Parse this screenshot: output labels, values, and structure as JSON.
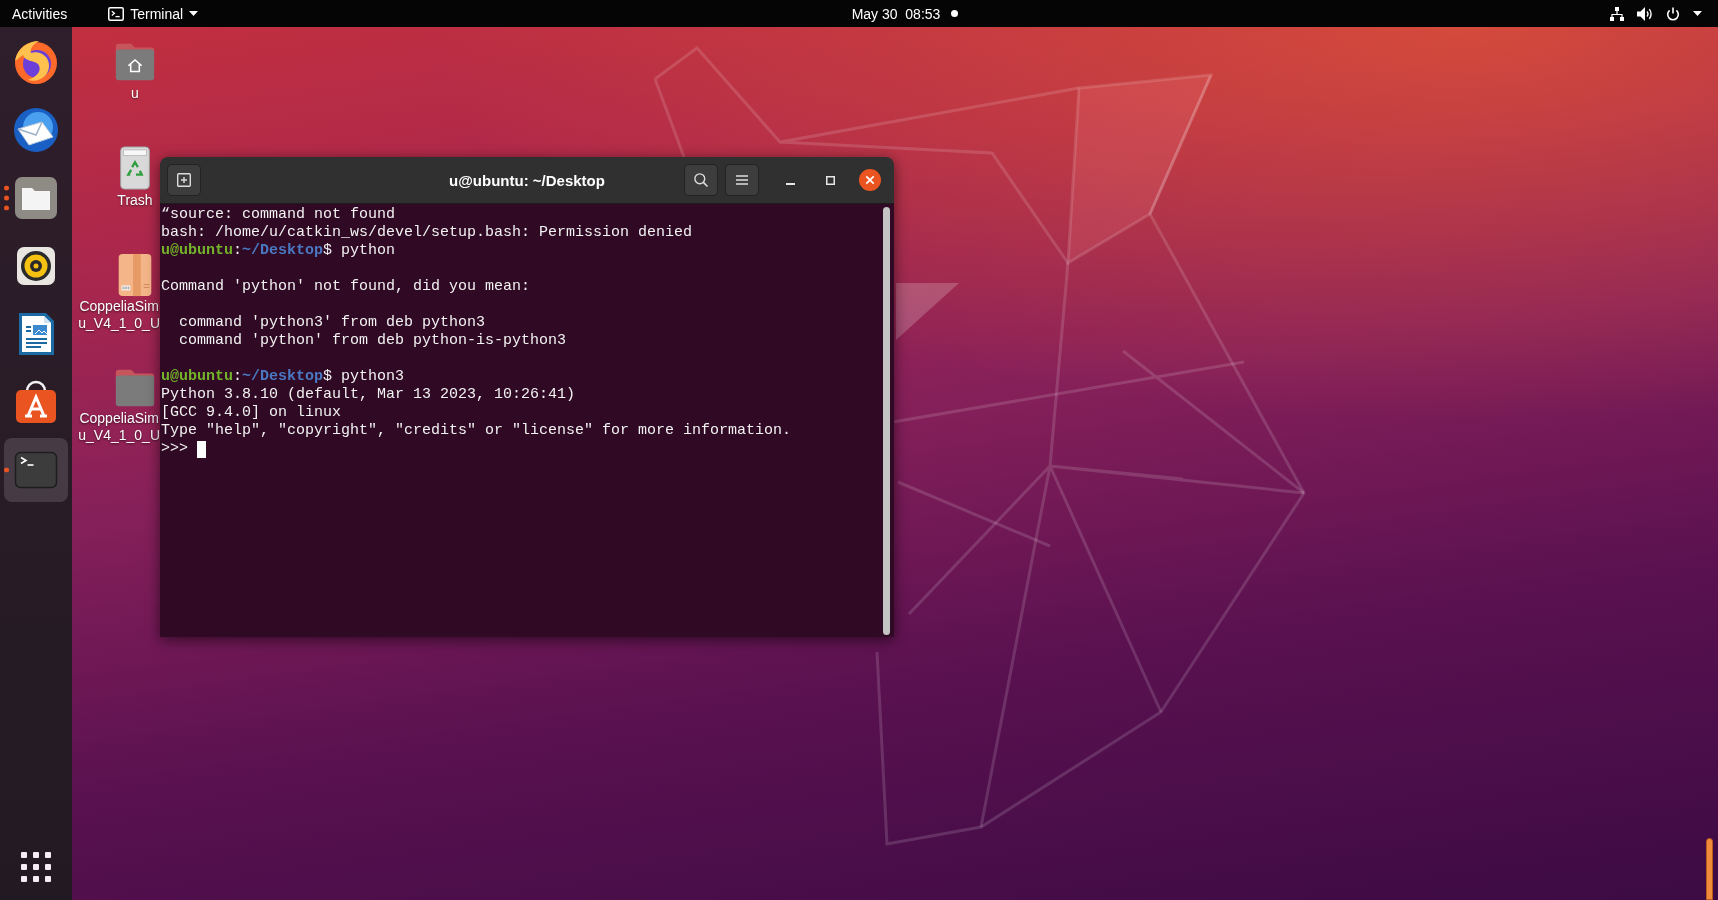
{
  "top_bar": {
    "activities": "Activities",
    "app_menu": "Terminal",
    "clock": "May 30  08:53",
    "notification": true
  },
  "dock": [
    {
      "kind": "browser",
      "running": false,
      "several_windows": false,
      "selected": false
    },
    {
      "kind": "mail",
      "running": false,
      "several_windows": false,
      "selected": false
    },
    {
      "kind": "files",
      "running": true,
      "several_windows": true,
      "selected": false
    },
    {
      "kind": "music",
      "running": false,
      "several_windows": false,
      "selected": false
    },
    {
      "kind": "writer",
      "running": false,
      "several_windows": false,
      "selected": false
    },
    {
      "kind": "software",
      "running": false,
      "several_windows": false,
      "selected": false
    },
    {
      "kind": "terminal",
      "running": true,
      "several_windows": false,
      "selected": true
    }
  ],
  "desktop_icons": [
    {
      "kind": "home",
      "label_lines": [
        "u"
      ]
    },
    {
      "kind": "trash",
      "label_lines": [
        "Trash"
      ]
    },
    {
      "kind": "package",
      "label_lines": [
        "CoppeliaSim",
        "u_V4_1_0_U"
      ]
    },
    {
      "kind": "folder",
      "label_lines": [
        "CoppeliaSim",
        "u_V4_1_0_U"
      ]
    }
  ],
  "terminal": {
    "title": "u@ubuntu: ~/Desktop",
    "lines": [
      {
        "kind": "output",
        "text": "“source: command not found"
      },
      {
        "kind": "output",
        "text": "bash: /home/u/catkin_ws/devel/setup.bash: Permission denied"
      },
      {
        "kind": "prompt",
        "user": "u@ubuntu",
        "separator": ":",
        "path": "~/Desktop",
        "symbol": "$",
        "command": "python"
      },
      {
        "kind": "blank"
      },
      {
        "kind": "output",
        "text": "Command 'python' not found, did you mean:"
      },
      {
        "kind": "blank"
      },
      {
        "kind": "output",
        "text": "  command 'python3' from deb python3"
      },
      {
        "kind": "output",
        "text": "  command 'python' from deb python-is-python3"
      },
      {
        "kind": "blank"
      },
      {
        "kind": "prompt",
        "user": "u@ubuntu",
        "separator": ":",
        "path": "~/Desktop",
        "symbol": "$",
        "command": "python3"
      },
      {
        "kind": "output",
        "text": "Python 3.8.10 (default, Mar 13 2023, 10:26:41)"
      },
      {
        "kind": "output",
        "text": "[GCC 9.4.0] on linux"
      },
      {
        "kind": "output",
        "text": "Type \"help\", \"copyright\", \"credits\" or \"license\" for more information."
      },
      {
        "kind": "repl",
        "text": ">>>",
        "cursor": true
      }
    ]
  }
}
